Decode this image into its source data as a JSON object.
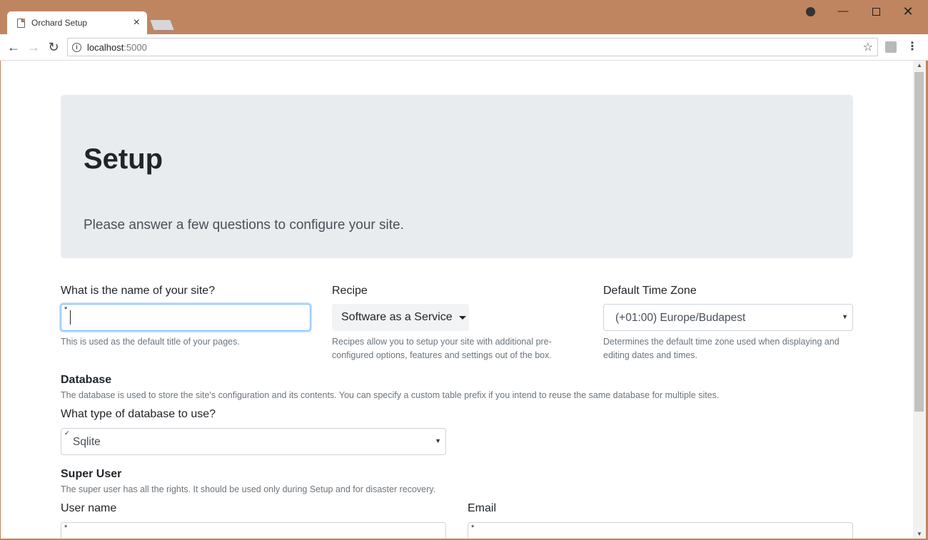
{
  "browser": {
    "tab_title": "Orchard Setup",
    "tab_close": "×",
    "url_host": "localhost",
    "url_port": ":5000"
  },
  "page": {
    "title": "Setup",
    "subtitle": "Please answer a few questions to configure your site.",
    "site_name": {
      "label": "What is the name of your site?",
      "value": "",
      "required_marker": "*",
      "help": "This is used as the default title of your pages."
    },
    "recipe": {
      "label": "Recipe",
      "selected": "Software as a Service",
      "help": "Recipes allow you to setup your site with additional pre-configured options, features and settings out of the box."
    },
    "timezone": {
      "label": "Default Time Zone",
      "selected": "(+01:00) Europe/Budapest",
      "help": "Determines the default time zone used when displaying and editing dates and times."
    },
    "database": {
      "section_title": "Database",
      "description": "The database is used to store the site's configuration and its contents. You can specify a custom table prefix if you intend to reuse the same database for multiple sites.",
      "type_label": "What type of database to use?",
      "selected": "Sqlite",
      "check_marker": "✓"
    },
    "super_user": {
      "section_title": "Super User",
      "description": "The super user has all the rights. It should be used only during Setup and for disaster recovery.",
      "username_label": "User name",
      "email_label": "Email",
      "required_marker": "*"
    }
  },
  "colors": {
    "window_frame": "#bf8560",
    "jumbotron_bg": "#e9ecef",
    "focus_border": "#80bdff"
  }
}
